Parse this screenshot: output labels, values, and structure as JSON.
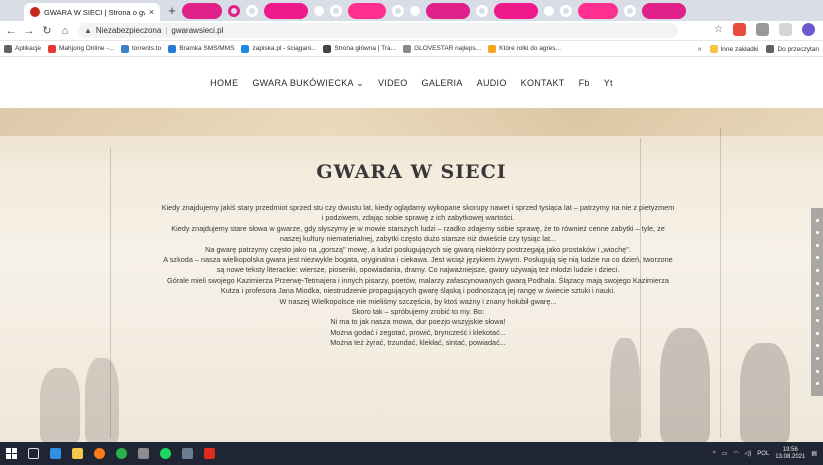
{
  "browser": {
    "tab_title": "GWARA W SIECI | Strona o gwa...",
    "tab_close": "×",
    "new_tab": "+",
    "url_security": "Niezabezpieczona",
    "url": "gwarawsieci.pl",
    "bookmarks": [
      {
        "label": "Aplikacje",
        "color": "#5f6368"
      },
      {
        "label": "Mahjong Online -...",
        "color": "#e53935"
      },
      {
        "label": "torrents.to",
        "color": "#3b82c4"
      },
      {
        "label": "Bramka SMS/MMS",
        "color": "#2a7bd5"
      },
      {
        "label": "zapiska.pl - ściągani...",
        "color": "#1e88e5"
      },
      {
        "label": "Strona główna | Tra...",
        "color": "#444444"
      },
      {
        "label": "GLOVESTAR najleps...",
        "color": "#888888"
      },
      {
        "label": "Które rolki do agres...",
        "color": "#f4a623"
      }
    ],
    "bookmarks_right": [
      {
        "label": "Inne zakładki",
        "color": "#f6c343"
      },
      {
        "label": "Do przeczytan",
        "color": "#5f6368"
      }
    ]
  },
  "site": {
    "nav": [
      {
        "label": "HOME"
      },
      {
        "label": "GWARA BUKÓWIECKA ⌄"
      },
      {
        "label": "VIDEO"
      },
      {
        "label": "GALERIA"
      },
      {
        "label": "AUDIO"
      },
      {
        "label": "KONTAKT"
      },
      {
        "label": "Fb"
      },
      {
        "label": "Yt"
      }
    ],
    "title": "GWARA W SIECI",
    "body": [
      "Kiedy znajdujemy jakiś stary przedmiot sprzed stu czy dwustu lat, kiedy oglądamy wykopane skorupy nawet i sprzed tysiąca lat – patrzymy na nie z pietyzmem i podziwem, zdając sobie sprawę z ich zabytkowej wartości.",
      "Kiedy znajdujemy stare słowa w gwarze, gdy słyszymy je w mowie starszych ludzi – rzadko zdajemy sobie sprawę, że to również cenne zabytki – tyle, że naszej kultury niematerialnej, zabytki często dużo starsze niż dwieście czy tysiąc lat...",
      "Na gwarę patrzymy często jako na „gorszą\" mowę, a ludzi posługujących się gwarą niektórzy postrzegają jako prostaków i „wiochę\".",
      "A szkoda – nasza wielkopolska gwara jest niezwykle bogata, oryginalna i ciekawa. Jest wciąż językiem żywym. Posługują się nią ludzie na co dzień, tworzone są nowe teksty literackie: wiersze, piosenki, opowiadania, dramy. Co najważniejsze, gwary używają też młodzi ludzie i dzieci.",
      "Górale mieli swojego Kazimierza Przerwę-Tetmajera i innych pisarzy, poetów, malarzy zafascynowanych gwarą Podhala. Ślązacy mają swojego Kazimierza Kutza i profesora Jana Miodka, niestrudzenie propagujących gwarę śląską i podnoszącą jej rangę w świecie sztuki i nauki.",
      "W naszej Wielkopolsce nie mieliśmy szczęścia, by ktoś ważny i znany hołubił gwarę...",
      "Skoro tak – spróbujemy zrobić to my. Bo:",
      "Ni ma to jak nasza mowa, dur poezjo wszyjskie słowa!",
      "Można godać i zegotać, prowić, bryncześć i klekotać...",
      "Można też żyrać, trzundać, klekłać, sintać, powiadać..."
    ]
  },
  "taskbar": {
    "apps": [
      {
        "name": "windows-start-icon",
        "color": "#4fb3ff"
      },
      {
        "name": "task-view-icon",
        "color": "#c9c9c9"
      },
      {
        "name": "store-icon",
        "color": "#2f8fe0"
      },
      {
        "name": "file-explorer-icon",
        "color": "#f2c94c"
      },
      {
        "name": "firefox-icon",
        "color": "#ff7a1a"
      },
      {
        "name": "chrome-icon",
        "color": "#2bb24c"
      },
      {
        "name": "app-icon",
        "color": "#8c8c8c"
      },
      {
        "name": "spotify-icon",
        "color": "#1ed760"
      },
      {
        "name": "calculator-icon",
        "color": "#6b7c93"
      },
      {
        "name": "acrobat-icon",
        "color": "#e02a1f"
      }
    ],
    "language": "POL",
    "time": "19:56",
    "date": "13.08.2021"
  }
}
